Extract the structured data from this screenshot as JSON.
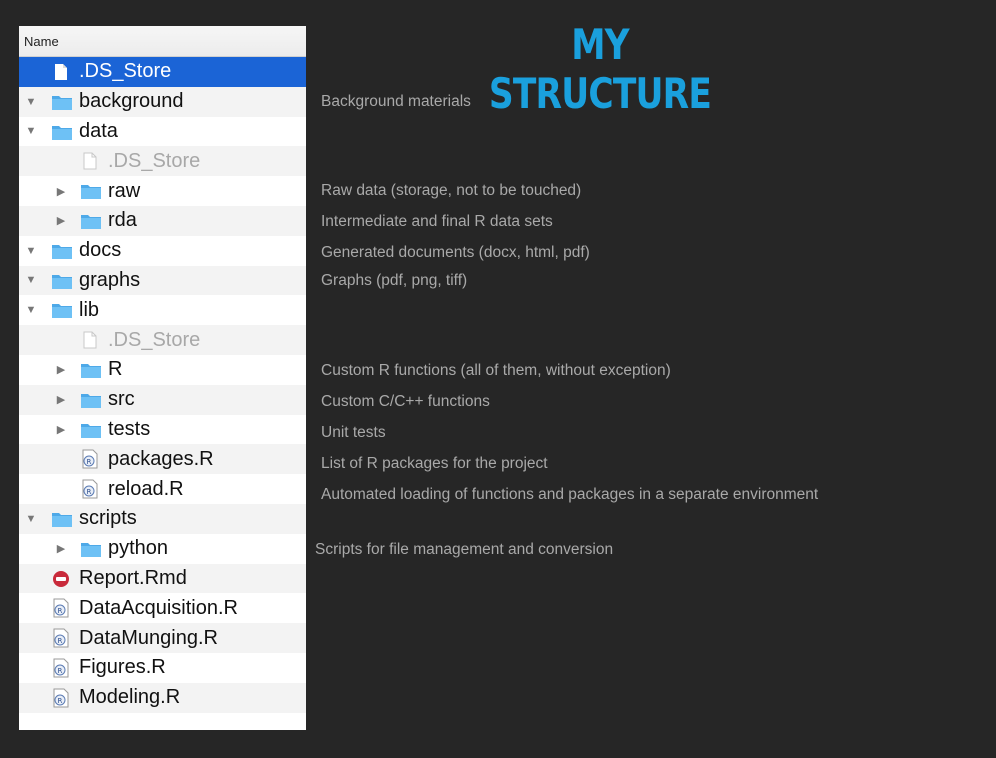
{
  "title": "MY STRUCTURE",
  "finder": {
    "column_header": "Name",
    "rows": [
      {
        "label": ".DS_Store",
        "kind": "file",
        "selected": true
      },
      {
        "label": "background",
        "kind": "folder",
        "expanded": true
      },
      {
        "label": "data",
        "kind": "folder",
        "expanded": true
      },
      {
        "label": ".DS_Store",
        "kind": "file",
        "dim": true
      },
      {
        "label": "raw",
        "kind": "folder",
        "expanded": false
      },
      {
        "label": "rda",
        "kind": "folder",
        "expanded": false
      },
      {
        "label": "docs",
        "kind": "folder",
        "expanded": true
      },
      {
        "label": "graphs",
        "kind": "folder",
        "expanded": true
      },
      {
        "label": "lib",
        "kind": "folder",
        "expanded": true
      },
      {
        "label": ".DS_Store",
        "kind": "file",
        "dim": true
      },
      {
        "label": "R",
        "kind": "folder",
        "expanded": false
      },
      {
        "label": "src",
        "kind": "folder",
        "expanded": false
      },
      {
        "label": "tests",
        "kind": "folder",
        "expanded": false
      },
      {
        "label": "packages.R",
        "kind": "r-script"
      },
      {
        "label": "reload.R",
        "kind": "r-script"
      },
      {
        "label": "scripts",
        "kind": "folder",
        "expanded": true
      },
      {
        "label": "python",
        "kind": "folder",
        "expanded": false
      },
      {
        "label": "Report.Rmd",
        "kind": "rmd"
      },
      {
        "label": "DataAcquisition.R",
        "kind": "r-script"
      },
      {
        "label": "DataMunging.R",
        "kind": "r-script"
      },
      {
        "label": "Figures.R",
        "kind": "r-script"
      },
      {
        "label": "Modeling.R",
        "kind": "r-script"
      }
    ]
  },
  "descriptions": {
    "background": "Background materials",
    "raw": "Raw data (storage, not to be touched)",
    "rda": "Intermediate and final R data sets",
    "docs": "Generated documents (docx, html, pdf)",
    "graphs": "Graphs (pdf, png, tiff)",
    "R": "Custom R functions (all of them, without exception)",
    "src": "Custom C/C++ functions",
    "tests": "Unit tests",
    "packages": "List of R packages for the project",
    "reload": "Automated loading of functions and packages in a separate environment",
    "python": "Scripts for file management and conversion"
  },
  "colors": {
    "background": "#262626",
    "title": "#1aa0dd",
    "selection": "#1b64d6",
    "folder": "#5ab5f0",
    "description": "#a9a9a9"
  }
}
